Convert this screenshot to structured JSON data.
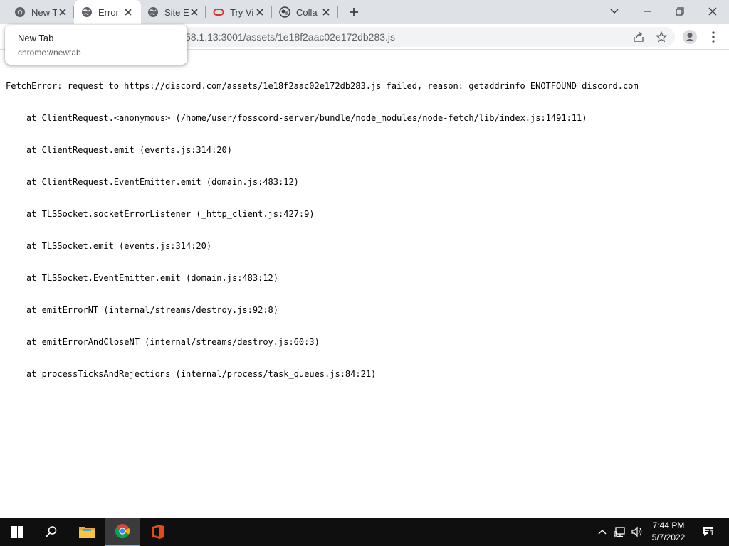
{
  "browser": {
    "tabs": [
      {
        "title": "New T",
        "icon": "chrome-icon",
        "active": false
      },
      {
        "title": "Error",
        "icon": "globe-icon",
        "active": true
      },
      {
        "title": "Site E",
        "icon": "globe-icon",
        "active": false
      },
      {
        "title": "Try Vi",
        "icon": "oracle-icon",
        "active": false
      },
      {
        "title": "Colla",
        "icon": "collab-icon",
        "active": false
      }
    ],
    "url": "58.1.13:3001/assets/1e18f2aac02e172db283.js",
    "hover_card": {
      "title": "New Tab",
      "url": "chrome://newtab"
    }
  },
  "page": {
    "first_line": "FetchError: request to https://discord.com/assets/1e18f2aac02e172db283.js failed, reason: getaddrinfo ENOTFOUND discord.com",
    "stack": [
      "at ClientRequest.<anonymous> (/home/user/fosscord-server/bundle/node_modules/node-fetch/lib/index.js:1491:11)",
      "at ClientRequest.emit (events.js:314:20)",
      "at ClientRequest.EventEmitter.emit (domain.js:483:12)",
      "at TLSSocket.socketErrorListener (_http_client.js:427:9)",
      "at TLSSocket.emit (events.js:314:20)",
      "at TLSSocket.EventEmitter.emit (domain.js:483:12)",
      "at emitErrorNT (internal/streams/destroy.js:92:8)",
      "at emitErrorAndCloseNT (internal/streams/destroy.js:60:3)",
      "at processTicksAndRejections (internal/process/task_queues.js:84:21)"
    ]
  },
  "taskbar": {
    "time": "7:44 PM",
    "date": "5/7/2022",
    "notification_count": "1"
  },
  "colors": {
    "tabstrip": "#dee1e6",
    "taskbar": "#0f0f10",
    "accent": "#76b9ed"
  }
}
